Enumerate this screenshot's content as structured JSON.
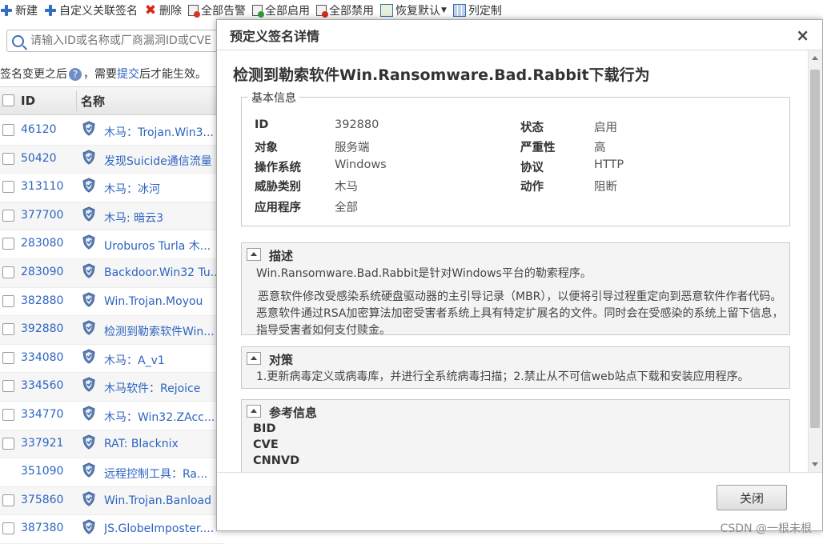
{
  "toolbar": {
    "buttons": [
      {
        "label": "新建",
        "icon": "plus-icon"
      },
      {
        "label": "自定义关联签名",
        "icon": "plus-icon"
      },
      {
        "label": "删除",
        "icon": "delete-x-icon"
      },
      {
        "label": "全部告警",
        "icon": "alert-doc-icon"
      },
      {
        "label": "全部启用",
        "icon": "enable-doc-icon"
      },
      {
        "label": "全部禁用",
        "icon": "disable-doc-icon"
      },
      {
        "label": "恢复默认",
        "icon": "restore-icon"
      },
      {
        "label": "列定制",
        "icon": "columns-icon"
      }
    ]
  },
  "search": {
    "placeholder": "请输入ID或名称或厂商漏洞ID或CVE"
  },
  "notice": {
    "prefix": "签名变更之后",
    "middle": "，需要",
    "link": "提交",
    "suffix": "后才能生效。",
    "help_icon": "?"
  },
  "grid": {
    "columns": {
      "id": "ID",
      "name": "名称"
    },
    "rows": [
      {
        "id": "46120",
        "name": "木马：Trojan.Win3..."
      },
      {
        "id": "50420",
        "name": "发现Suicide通信流量"
      },
      {
        "id": "313110",
        "name": "木马：冰河"
      },
      {
        "id": "377700",
        "name": "木马: 暗云3"
      },
      {
        "id": "283080",
        "name": "Uroburos Turla 木..."
      },
      {
        "id": "283090",
        "name": "Backdoor.Win32 Tu..."
      },
      {
        "id": "382880",
        "name": "Win.Trojan.Moyou"
      },
      {
        "id": "392880",
        "name": "检测到勒索软件Win..."
      },
      {
        "id": "334080",
        "name": "木马：A_v1"
      },
      {
        "id": "334560",
        "name": "木马软件：Rejoice"
      },
      {
        "id": "334770",
        "name": "木马：Win32.ZAcc..."
      },
      {
        "id": "337921",
        "name": "RAT: Blacknix"
      },
      {
        "id": "351090",
        "name": "远程控制工具：Ra..."
      },
      {
        "id": "375860",
        "name": "Win.Trojan.Banload"
      },
      {
        "id": "387380",
        "name": "JS.GlobeImposter...."
      }
    ]
  },
  "dialog": {
    "title": "预定义签名详情",
    "close_icon": "×",
    "signature_title": "检测到勒索软件Win.Ransomware.Bad.Rabbit下载行为",
    "basic": {
      "legend": "基本信息",
      "id_label": "ID",
      "id_value": "392880",
      "object_label": "对象",
      "object_value": "服务端",
      "os_label": "操作系统",
      "os_value": "Windows",
      "threat_label": "威胁类别",
      "threat_value": "木马",
      "app_label": "应用程序",
      "app_value": "全部",
      "status_label": "状态",
      "status_value": "启用",
      "severity_label": "严重性",
      "severity_value": "高",
      "protocol_label": "协议",
      "protocol_value": "HTTP",
      "action_label": "动作",
      "action_value": "阻断"
    },
    "description": {
      "title": "描述",
      "line1": "Win.Ransomware.Bad.Rabbit是针对Windows平台的勒索程序。",
      "line2": "恶意软件修改受感染系统硬盘驱动器的主引导记录（MBR），以便将引导过程重定向到恶意软件作者代码。恶意软件通过RSA加密算法加密受害者系统上具有特定扩展名的文件。同时会在受感染的系统上留下信息，指导受害者如何支付赎金。"
    },
    "countermeasure": {
      "title": "对策",
      "text": "1.更新病毒定义或病毒库，并进行全系统病毒扫描；2.禁止从不可信web站点下载和安装应用程序。"
    },
    "references": {
      "title": "参考信息",
      "items": [
        "BID",
        "CVE",
        "CNNVD"
      ]
    },
    "close_button": "关闭"
  },
  "watermark": "CSDN @一根未根"
}
